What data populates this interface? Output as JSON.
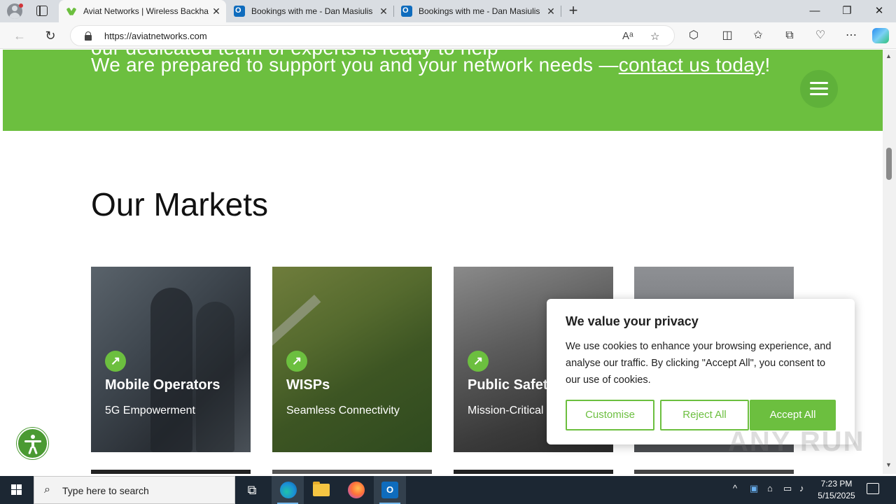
{
  "browser": {
    "tabs": [
      {
        "title": "Aviat Networks | Wireless Backha",
        "favicon": "aviat-logo-icon",
        "active": true
      },
      {
        "title": "Bookings with me - Dan Masiulis",
        "favicon": "outlook-icon",
        "active": false
      },
      {
        "title": "Bookings with me - Dan Masiulis",
        "favicon": "outlook-icon",
        "active": false
      }
    ],
    "address": "https://aviatnetworks.com",
    "window_controls": {
      "minimize": "—",
      "restore": "❐",
      "close": "✕"
    }
  },
  "page": {
    "band_cut_text": "our dedicated team of experts is ready to help",
    "band_text": "We are prepared to support you and your network needs —",
    "band_link": "contact us today",
    "band_suffix": "!",
    "markets_heading": "Our Markets",
    "cards": [
      {
        "title": "Mobile Operators",
        "subtitle": "5G Empowerment"
      },
      {
        "title": "WISPs",
        "subtitle": "Seamless Connectivity"
      },
      {
        "title": "Public Safety",
        "subtitle": "Mission-Critical Reliability"
      },
      {
        "title": "",
        "subtitle": ""
      }
    ],
    "accent_color": "#6cbf3f"
  },
  "cookie_banner": {
    "title": "We value your privacy",
    "text": "We use cookies to enhance your browsing experience, and analyse our traffic. By clicking \"Accept All\", you consent to our use of cookies.",
    "customise": "Customise",
    "reject": "Reject All",
    "accept": "Accept All"
  },
  "watermark": "ANY RUN",
  "taskbar": {
    "search_placeholder": "Type here to search",
    "time": "7:23 PM",
    "date": "5/15/2025"
  }
}
